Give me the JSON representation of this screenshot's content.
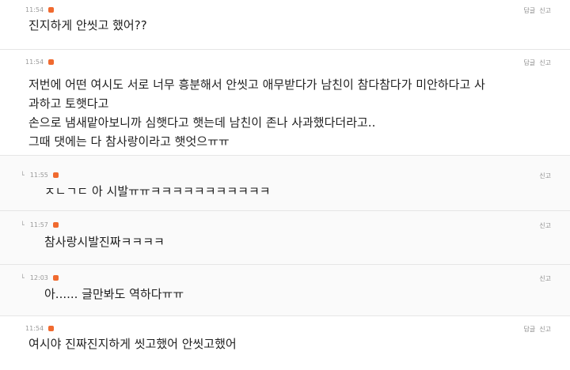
{
  "labels": {
    "reply": "답글",
    "report": "신고"
  },
  "comments": [
    {
      "time": "11:54",
      "lines": [
        "진지하게 안씻고 했어??"
      ]
    },
    {
      "time": "11:54",
      "lines": [
        "저번에 어떤 여시도 서로 너무 흥분해서 안씻고 애무받다가 남친이 참다참다가 미안하다고 사",
        "과하고 토햇다고",
        "손으로 냄새맡아보니까 심햇다고 햇는데 남친이 존나 사과했다더라고..",
        "그때 댓에는 다 참사랑이라고 햇엇으ㅠㅠ"
      ]
    },
    {
      "time": "11:55",
      "reply": true,
      "lines": [
        "ㅈㄴㄱㄷ 아 시발ㅠㅠㅋㅋㅋㅋㅋㅋㅋㅋㅋㅋㅋ"
      ]
    },
    {
      "time": "11:57",
      "reply": true,
      "lines": [
        "참사랑시발진짜ㅋㅋㅋㅋ"
      ]
    },
    {
      "time": "12:03",
      "reply": true,
      "lines": [
        "아...... 글만봐도 역하다ㅠㅠ"
      ]
    },
    {
      "time": "11:54",
      "lines": [
        "여시야 진짜진지하게 씻고했어 안씻고했어"
      ]
    }
  ]
}
